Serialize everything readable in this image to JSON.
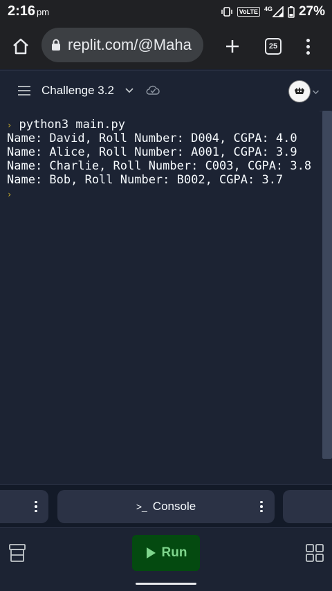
{
  "status_bar": {
    "time": "2:16",
    "ampm": "pm",
    "network": "VoLTE",
    "signal": "4G",
    "battery": "27%"
  },
  "browser": {
    "url": "replit.com/@Maha",
    "tab_count": "25"
  },
  "repl": {
    "title": "Challenge 3.2"
  },
  "console": {
    "command": "python3 main.py",
    "output": [
      "Name: David, Roll Number: D004, CGPA: 4.0",
      "Name: Alice, Roll Number: A001, CGPA: 3.9",
      "Name: Charlie, Roll Number: C003, CGPA: 3.8",
      "Name: Bob, Roll Number: B002, CGPA: 3.7"
    ]
  },
  "panes": {
    "console_icon": ">_",
    "console_label": "Console"
  },
  "actions": {
    "run_label": "Run"
  }
}
